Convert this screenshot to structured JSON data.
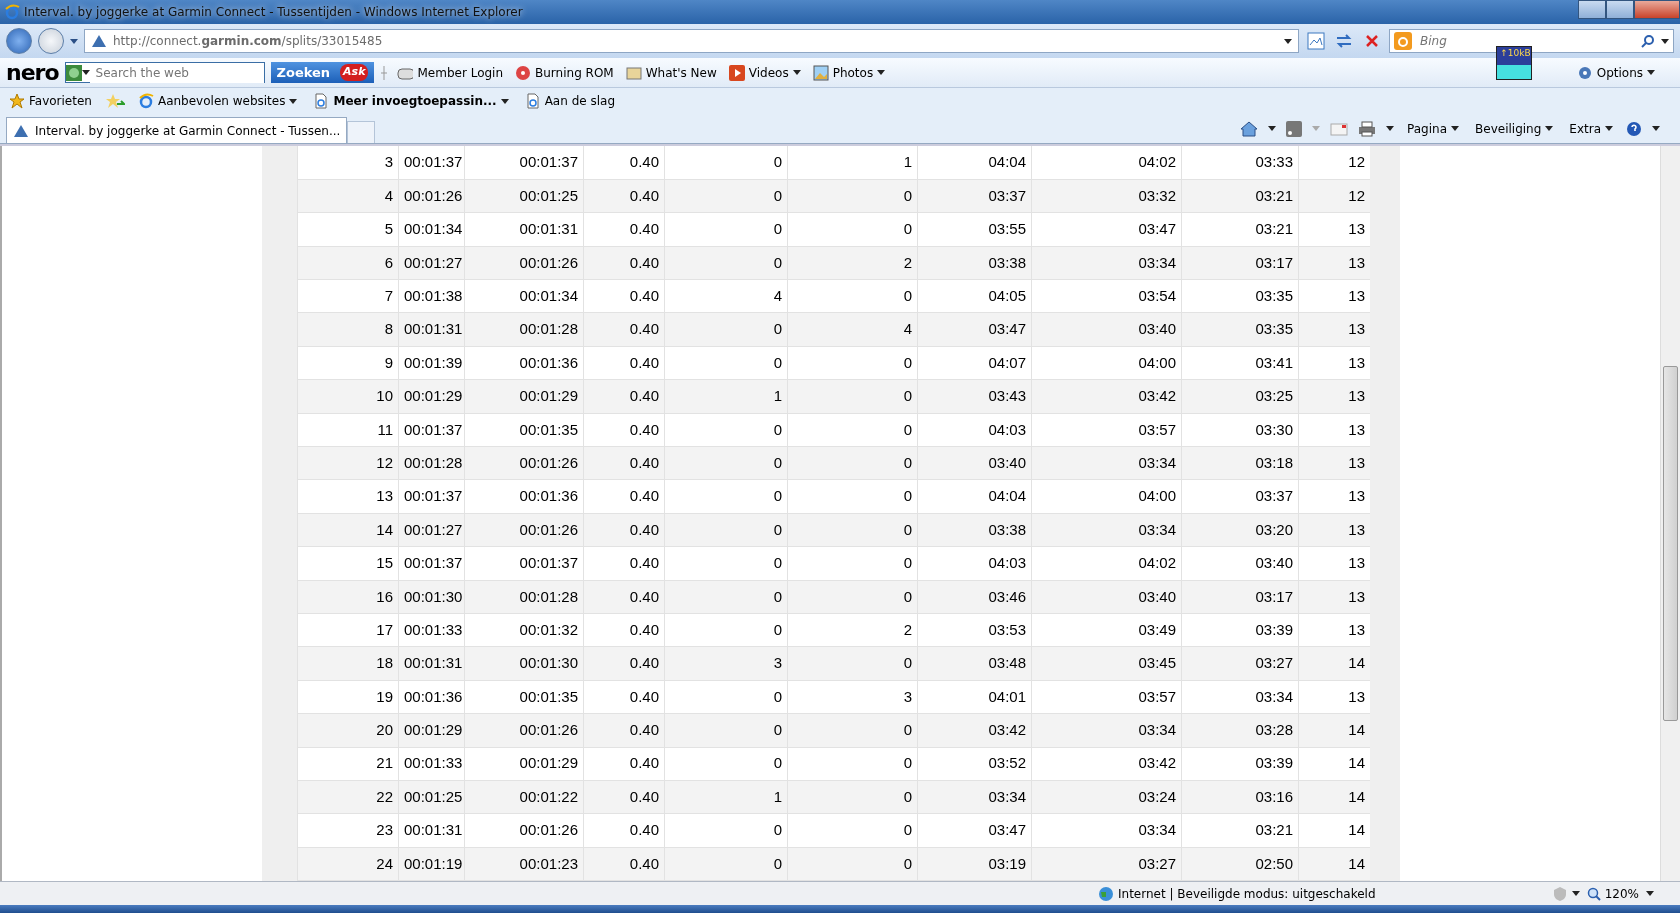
{
  "window": {
    "title": "Interval. by joggerke at Garmin Connect - Tussentijden - Windows Internet Explorer"
  },
  "address_bar": {
    "url": "http://connect.**garmin.com**/splits/33015485",
    "search_placeholder": "Bing"
  },
  "nero_toolbar": {
    "logo": "nero",
    "search_placeholder": "Search the web",
    "search_button": "Zoeken",
    "ask_logo": "Ask",
    "meter_label": "↑10kB",
    "options": "Options",
    "items": [
      {
        "kind": "user",
        "label": "Member Login",
        "dropdown": false
      },
      {
        "kind": "disc",
        "label": "Burning ROM",
        "dropdown": false
      },
      {
        "kind": "news",
        "label": "What's New",
        "dropdown": false
      },
      {
        "kind": "video",
        "label": "Videos",
        "dropdown": true
      },
      {
        "kind": "photo",
        "label": "Photos",
        "dropdown": true
      }
    ]
  },
  "favorites_bar": {
    "favorites": "Favorieten",
    "items": [
      {
        "kind": "ie",
        "label": "Aanbevolen websites",
        "dropdown": true,
        "bold": false
      },
      {
        "kind": "page",
        "label": "Meer invoegtoepassin...",
        "dropdown": true,
        "bold": true
      },
      {
        "kind": "page",
        "label": "Aan de slag",
        "dropdown": false,
        "bold": false
      }
    ]
  },
  "tabs": [
    {
      "label": "Interval. by joggerke at Garmin Connect - Tussen...",
      "selected": true
    }
  ],
  "command_bar": {
    "menus": [
      "Pagina",
      "Beveiliging",
      "Extra"
    ]
  },
  "table": {
    "rows": [
      [
        "3",
        "00:01:37",
        "00:01:37",
        "0.40",
        "0",
        "1",
        "04:04",
        "04:02",
        "03:33",
        "12"
      ],
      [
        "4",
        "00:01:26",
        "00:01:25",
        "0.40",
        "0",
        "0",
        "03:37",
        "03:32",
        "03:21",
        "12"
      ],
      [
        "5",
        "00:01:34",
        "00:01:31",
        "0.40",
        "0",
        "0",
        "03:55",
        "03:47",
        "03:21",
        "13"
      ],
      [
        "6",
        "00:01:27",
        "00:01:26",
        "0.40",
        "0",
        "2",
        "03:38",
        "03:34",
        "03:17",
        "13"
      ],
      [
        "7",
        "00:01:38",
        "00:01:34",
        "0.40",
        "4",
        "0",
        "04:05",
        "03:54",
        "03:35",
        "13"
      ],
      [
        "8",
        "00:01:31",
        "00:01:28",
        "0.40",
        "0",
        "4",
        "03:47",
        "03:40",
        "03:35",
        "13"
      ],
      [
        "9",
        "00:01:39",
        "00:01:36",
        "0.40",
        "0",
        "0",
        "04:07",
        "04:00",
        "03:41",
        "13"
      ],
      [
        "10",
        "00:01:29",
        "00:01:29",
        "0.40",
        "1",
        "0",
        "03:43",
        "03:42",
        "03:25",
        "13"
      ],
      [
        "11",
        "00:01:37",
        "00:01:35",
        "0.40",
        "0",
        "0",
        "04:03",
        "03:57",
        "03:30",
        "13"
      ],
      [
        "12",
        "00:01:28",
        "00:01:26",
        "0.40",
        "0",
        "0",
        "03:40",
        "03:34",
        "03:18",
        "13"
      ],
      [
        "13",
        "00:01:37",
        "00:01:36",
        "0.40",
        "0",
        "0",
        "04:04",
        "04:00",
        "03:37",
        "13"
      ],
      [
        "14",
        "00:01:27",
        "00:01:26",
        "0.40",
        "0",
        "0",
        "03:38",
        "03:34",
        "03:20",
        "13"
      ],
      [
        "15",
        "00:01:37",
        "00:01:37",
        "0.40",
        "0",
        "0",
        "04:03",
        "04:02",
        "03:40",
        "13"
      ],
      [
        "16",
        "00:01:30",
        "00:01:28",
        "0.40",
        "0",
        "0",
        "03:46",
        "03:40",
        "03:17",
        "13"
      ],
      [
        "17",
        "00:01:33",
        "00:01:32",
        "0.40",
        "0",
        "2",
        "03:53",
        "03:49",
        "03:39",
        "13"
      ],
      [
        "18",
        "00:01:31",
        "00:01:30",
        "0.40",
        "3",
        "0",
        "03:48",
        "03:45",
        "03:27",
        "14"
      ],
      [
        "19",
        "00:01:36",
        "00:01:35",
        "0.40",
        "0",
        "3",
        "04:01",
        "03:57",
        "03:34",
        "13"
      ],
      [
        "20",
        "00:01:29",
        "00:01:26",
        "0.40",
        "0",
        "0",
        "03:42",
        "03:34",
        "03:28",
        "14"
      ],
      [
        "21",
        "00:01:33",
        "00:01:29",
        "0.40",
        "0",
        "0",
        "03:52",
        "03:42",
        "03:39",
        "14"
      ],
      [
        "22",
        "00:01:25",
        "00:01:22",
        "0.40",
        "1",
        "0",
        "03:34",
        "03:24",
        "03:16",
        "14"
      ],
      [
        "23",
        "00:01:31",
        "00:01:26",
        "0.40",
        "0",
        "0",
        "03:47",
        "03:34",
        "03:21",
        "14"
      ],
      [
        "24",
        "00:01:19",
        "00:01:23",
        "0.40",
        "0",
        "0",
        "03:19",
        "03:27",
        "02:50",
        "14"
      ]
    ]
  },
  "status_bar": {
    "zone": "Internet | Beveiligde modus: uitgeschakeld",
    "zoom": "120%"
  }
}
